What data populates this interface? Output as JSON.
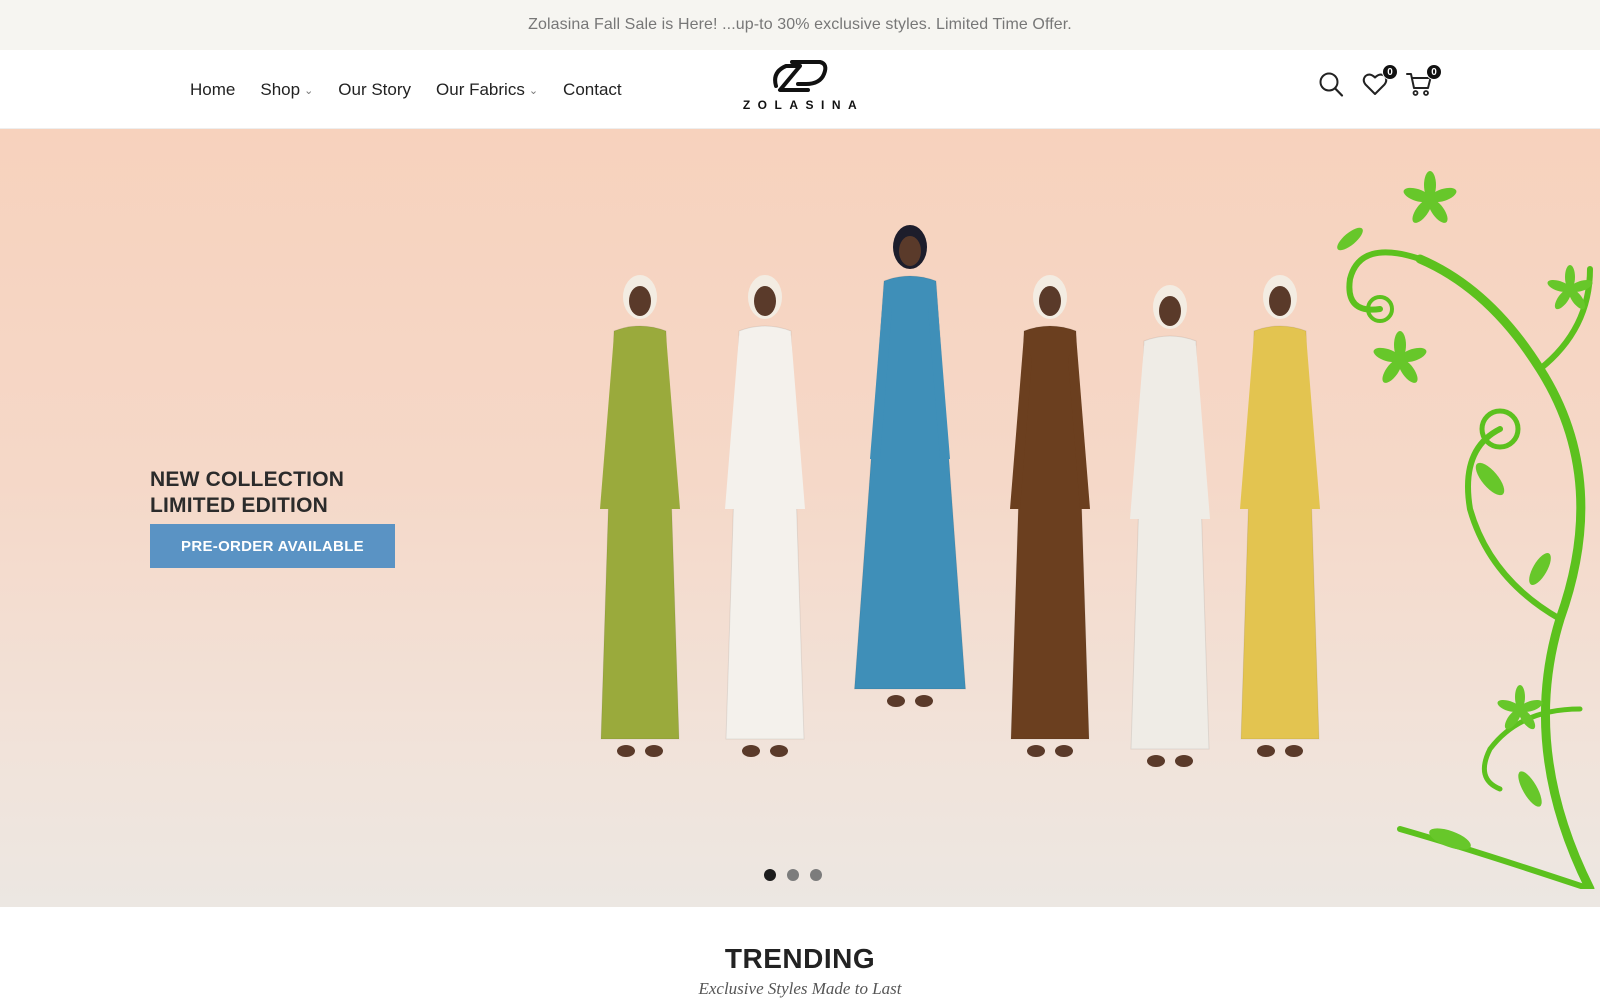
{
  "announcement": {
    "text": "Zolasina Fall Sale is Here! ...up-to 30% exclusive styles. Limited Time Offer."
  },
  "nav": {
    "items": [
      {
        "label": "Home",
        "has_dropdown": false
      },
      {
        "label": "Shop",
        "has_dropdown": true
      },
      {
        "label": "Our Story",
        "has_dropdown": false
      },
      {
        "label": "Our Fabrics",
        "has_dropdown": true
      },
      {
        "label": "Contact",
        "has_dropdown": false
      }
    ]
  },
  "logo": {
    "wordmark": "ZOLASINA"
  },
  "header_icons": {
    "search": {
      "icon": "search-icon"
    },
    "wishlist": {
      "icon": "heart-icon",
      "count": "0"
    },
    "cart": {
      "icon": "cart-icon",
      "count": "0"
    }
  },
  "hero": {
    "line1": "NEW COLLECTION",
    "line2": "LIMITED EDITION",
    "cta_label": "PRE-ORDER AVAILABLE",
    "slides_total": 3,
    "active_slide": 1,
    "outfit_colors": [
      "#9aaa3c",
      "#f4f1ec",
      "#3f8fb8",
      "#6b3f1f",
      "#efece6",
      "#e3c450"
    ],
    "accent_color": "#5a93c4",
    "vine_color": "#5cc11e"
  },
  "trending": {
    "title": "TRENDING",
    "subtitle": "Exclusive Styles Made to Last"
  }
}
